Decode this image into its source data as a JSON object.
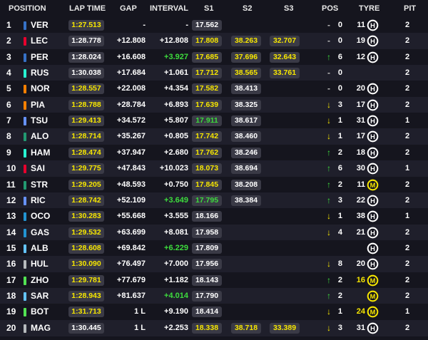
{
  "header": {
    "position": "POSITION",
    "lap_time": "LAP TIME",
    "gap": "GAP",
    "interval": "INTERVAL",
    "s1": "S1",
    "s2": "S2",
    "s3": "S3",
    "pos": "POS",
    "tyre": "TYRE",
    "pit": "PIT"
  },
  "colors": {
    "yellow": "#f6e600",
    "green": "#3ddc3d",
    "purple_best": "#a020f0",
    "row_alt": "#1f1f2b",
    "background": "#15151e",
    "pill": "#3a3a46"
  },
  "rows": [
    {
      "pos": "1",
      "driver": "VER",
      "team_color": "#3671c6",
      "lap": "1:27.513",
      "lap_c": "yellow",
      "gap": "-",
      "gap_c": "white",
      "int": "-",
      "int_c": "white",
      "s1": "17.562",
      "s1_c": "white",
      "s2": "",
      "s2_c": "white",
      "s3": "",
      "s3_c": "white",
      "arrow": "",
      "arrow_c": "white",
      "pchange": "0",
      "laps": "11",
      "tyre": "H",
      "tyre_c": "#ffffff",
      "pit": "2"
    },
    {
      "pos": "2",
      "driver": "LEC",
      "team_color": "#e8002d",
      "lap": "1:28.778",
      "lap_c": "white",
      "gap": "+12.808",
      "gap_c": "white",
      "int": "+12.808",
      "int_c": "white",
      "s1": "17.808",
      "s1_c": "yellow",
      "s2": "38.263",
      "s2_c": "yellow",
      "s3": "32.707",
      "s3_c": "yellow",
      "arrow": "",
      "arrow_c": "white",
      "pchange": "0",
      "laps": "19",
      "tyre": "H",
      "tyre_c": "#ffffff",
      "pit": "2"
    },
    {
      "pos": "3",
      "driver": "PER",
      "team_color": "#3671c6",
      "lap": "1:28.024",
      "lap_c": "white",
      "gap": "+16.608",
      "gap_c": "white",
      "int": "+3.927",
      "int_c": "green",
      "s1": "17.685",
      "s1_c": "yellow",
      "s2": "37.696",
      "s2_c": "yellow",
      "s3": "32.643",
      "s3_c": "yellow",
      "arrow": "↑",
      "arrow_c": "green",
      "pchange": "6",
      "laps": "12",
      "tyre": "H",
      "tyre_c": "#ffffff",
      "pit": "2"
    },
    {
      "pos": "4",
      "driver": "RUS",
      "team_color": "#27f4d2",
      "lap": "1:30.038",
      "lap_c": "white",
      "gap": "+17.684",
      "gap_c": "white",
      "int": "+1.061",
      "int_c": "white",
      "s1": "17.712",
      "s1_c": "yellow",
      "s2": "38.565",
      "s2_c": "yellow",
      "s3": "33.761",
      "s3_c": "yellow",
      "arrow": "",
      "arrow_c": "white",
      "pchange": "0",
      "laps": "",
      "tyre": "",
      "tyre_c": "",
      "pit": "2"
    },
    {
      "pos": "5",
      "driver": "NOR",
      "team_color": "#ff8000",
      "lap": "1:28.557",
      "lap_c": "yellow",
      "gap": "+22.008",
      "gap_c": "white",
      "int": "+4.354",
      "int_c": "white",
      "s1": "17.582",
      "s1_c": "yellow",
      "s2": "38.413",
      "s2_c": "white",
      "s3": "",
      "s3_c": "white",
      "arrow": "",
      "arrow_c": "white",
      "pchange": "0",
      "laps": "20",
      "tyre": "H",
      "tyre_c": "#ffffff",
      "pit": "2"
    },
    {
      "pos": "6",
      "driver": "PIA",
      "team_color": "#ff8000",
      "lap": "1:28.788",
      "lap_c": "yellow",
      "gap": "+28.784",
      "gap_c": "white",
      "int": "+6.893",
      "int_c": "white",
      "s1": "17.639",
      "s1_c": "yellow",
      "s2": "38.325",
      "s2_c": "white",
      "s3": "",
      "s3_c": "white",
      "arrow": "↓",
      "arrow_c": "yellow",
      "pchange": "3",
      "laps": "17",
      "tyre": "H",
      "tyre_c": "#ffffff",
      "pit": "2"
    },
    {
      "pos": "7",
      "driver": "TSU",
      "team_color": "#6692ff",
      "lap": "1:29.413",
      "lap_c": "yellow",
      "gap": "+34.572",
      "gap_c": "white",
      "int": "+5.807",
      "int_c": "white",
      "s1": "17.911",
      "s1_c": "green",
      "s2": "38.617",
      "s2_c": "white",
      "s3": "",
      "s3_c": "white",
      "arrow": "↓",
      "arrow_c": "yellow",
      "pchange": "1",
      "laps": "31",
      "tyre": "H",
      "tyre_c": "#ffffff",
      "pit": "1"
    },
    {
      "pos": "8",
      "driver": "ALO",
      "team_color": "#229971",
      "lap": "1:28.714",
      "lap_c": "yellow",
      "gap": "+35.267",
      "gap_c": "white",
      "int": "+0.805",
      "int_c": "white",
      "s1": "17.742",
      "s1_c": "yellow",
      "s2": "38.460",
      "s2_c": "white",
      "s3": "",
      "s3_c": "white",
      "arrow": "↓",
      "arrow_c": "yellow",
      "pchange": "1",
      "laps": "17",
      "tyre": "H",
      "tyre_c": "#ffffff",
      "pit": "2"
    },
    {
      "pos": "9",
      "driver": "HAM",
      "team_color": "#27f4d2",
      "lap": "1:28.474",
      "lap_c": "yellow",
      "gap": "+37.947",
      "gap_c": "white",
      "int": "+2.680",
      "int_c": "white",
      "s1": "17.762",
      "s1_c": "yellow",
      "s2": "38.246",
      "s2_c": "white",
      "s3": "",
      "s3_c": "white",
      "arrow": "↑",
      "arrow_c": "green",
      "pchange": "2",
      "laps": "18",
      "tyre": "H",
      "tyre_c": "#ffffff",
      "pit": "2"
    },
    {
      "pos": "10",
      "driver": "SAI",
      "team_color": "#e8002d",
      "lap": "1:29.775",
      "lap_c": "yellow",
      "gap": "+47.843",
      "gap_c": "white",
      "int": "+10.023",
      "int_c": "white",
      "s1": "18.073",
      "s1_c": "yellow",
      "s2": "38.694",
      "s2_c": "white",
      "s3": "",
      "s3_c": "white",
      "arrow": "↑",
      "arrow_c": "green",
      "pchange": "6",
      "laps": "30",
      "tyre": "H",
      "tyre_c": "#ffffff",
      "pit": "1"
    },
    {
      "pos": "11",
      "driver": "STR",
      "team_color": "#229971",
      "lap": "1:29.205",
      "lap_c": "yellow",
      "gap": "+48.593",
      "gap_c": "white",
      "int": "+0.750",
      "int_c": "white",
      "s1": "17.845",
      "s1_c": "yellow",
      "s2": "38.208",
      "s2_c": "white",
      "s3": "",
      "s3_c": "white",
      "arrow": "↑",
      "arrow_c": "green",
      "pchange": "2",
      "laps": "11",
      "tyre": "M",
      "tyre_c": "#f6e600",
      "pit": "2"
    },
    {
      "pos": "12",
      "driver": "RIC",
      "team_color": "#6692ff",
      "lap": "1:28.742",
      "lap_c": "yellow",
      "gap": "+52.109",
      "gap_c": "white",
      "int": "+3.649",
      "int_c": "green",
      "s1": "17.795",
      "s1_c": "green",
      "s2": "38.384",
      "s2_c": "white",
      "s3": "",
      "s3_c": "white",
      "arrow": "↑",
      "arrow_c": "green",
      "pchange": "3",
      "laps": "22",
      "tyre": "H",
      "tyre_c": "#ffffff",
      "pit": "2"
    },
    {
      "pos": "13",
      "driver": "OCO",
      "team_color": "#2293d1",
      "lap": "1:30.283",
      "lap_c": "yellow",
      "gap": "+55.668",
      "gap_c": "white",
      "int": "+3.555",
      "int_c": "white",
      "s1": "18.166",
      "s1_c": "white",
      "s2": "",
      "s2_c": "white",
      "s3": "",
      "s3_c": "white",
      "arrow": "↓",
      "arrow_c": "yellow",
      "pchange": "1",
      "laps": "38",
      "tyre": "H",
      "tyre_c": "#ffffff",
      "pit": "1"
    },
    {
      "pos": "14",
      "driver": "GAS",
      "team_color": "#2293d1",
      "lap": "1:29.532",
      "lap_c": "yellow",
      "gap": "+63.699",
      "gap_c": "white",
      "int": "+8.081",
      "int_c": "white",
      "s1": "17.958",
      "s1_c": "white",
      "s2": "",
      "s2_c": "white",
      "s3": "",
      "s3_c": "white",
      "arrow": "↓",
      "arrow_c": "yellow",
      "pchange": "4",
      "laps": "21",
      "tyre": "H",
      "tyre_c": "#ffffff",
      "pit": "2"
    },
    {
      "pos": "15",
      "driver": "ALB",
      "team_color": "#64c4ff",
      "lap": "1:28.608",
      "lap_c": "yellow",
      "gap": "+69.842",
      "gap_c": "white",
      "int": "+6.229",
      "int_c": "green",
      "s1": "17.809",
      "s1_c": "white",
      "s2": "",
      "s2_c": "white",
      "s3": "",
      "s3_c": "white",
      "arrow": "",
      "arrow_c": "white",
      "pchange": "",
      "laps": "",
      "tyre": "H",
      "tyre_c": "#ffffff",
      "pit": "2"
    },
    {
      "pos": "16",
      "driver": "HUL",
      "team_color": "#b6babd",
      "lap": "1:30.090",
      "lap_c": "yellow",
      "gap": "+76.497",
      "gap_c": "white",
      "int": "+7.000",
      "int_c": "white",
      "s1": "17.956",
      "s1_c": "white",
      "s2": "",
      "s2_c": "white",
      "s3": "",
      "s3_c": "white",
      "arrow": "↓",
      "arrow_c": "yellow",
      "pchange": "8",
      "laps": "20",
      "tyre": "H",
      "tyre_c": "#ffffff",
      "pit": "2"
    },
    {
      "pos": "17",
      "driver": "ZHO",
      "team_color": "#52e252",
      "lap": "1:29.781",
      "lap_c": "yellow",
      "gap": "+77.679",
      "gap_c": "white",
      "int": "+1.182",
      "int_c": "white",
      "s1": "18.143",
      "s1_c": "white",
      "s2": "",
      "s2_c": "white",
      "s3": "",
      "s3_c": "white",
      "arrow": "↑",
      "arrow_c": "green",
      "pchange": "2",
      "laps": "16",
      "laps_c": "yellow",
      "tyre": "M",
      "tyre_c": "#f6e600",
      "pit": "2"
    },
    {
      "pos": "18",
      "driver": "SAR",
      "team_color": "#64c4ff",
      "lap": "1:28.943",
      "lap_c": "yellow",
      "gap": "+81.637",
      "gap_c": "white",
      "int": "+4.014",
      "int_c": "green",
      "s1": "17.790",
      "s1_c": "white",
      "s2": "",
      "s2_c": "white",
      "s3": "",
      "s3_c": "white",
      "arrow": "↑",
      "arrow_c": "green",
      "pchange": "2",
      "laps": "",
      "tyre": "M",
      "tyre_c": "#f6e600",
      "pit": "2"
    },
    {
      "pos": "19",
      "driver": "BOT",
      "team_color": "#52e252",
      "lap": "1:31.713",
      "lap_c": "yellow",
      "gap": "1 L",
      "gap_c": "white",
      "int": "+9.190",
      "int_c": "white",
      "s1": "18.414",
      "s1_c": "white",
      "s2": "",
      "s2_c": "white",
      "s3": "",
      "s3_c": "white",
      "arrow": "↓",
      "arrow_c": "yellow",
      "pchange": "1",
      "laps": "24",
      "laps_c": "yellow",
      "tyre": "M",
      "tyre_c": "#f6e600",
      "pit": "1"
    },
    {
      "pos": "20",
      "driver": "MAG",
      "team_color": "#b6babd",
      "lap": "1:30.445",
      "lap_c": "white",
      "gap": "1 L",
      "gap_c": "white",
      "int": "+2.253",
      "int_c": "white",
      "s1": "18.338",
      "s1_c": "yellow",
      "s2": "38.718",
      "s2_c": "yellow",
      "s3": "33.389",
      "s3_c": "yellow",
      "arrow": "↓",
      "arrow_c": "yellow",
      "pchange": "3",
      "laps": "31",
      "tyre": "H",
      "tyre_c": "#ffffff",
      "pit": "2"
    }
  ]
}
